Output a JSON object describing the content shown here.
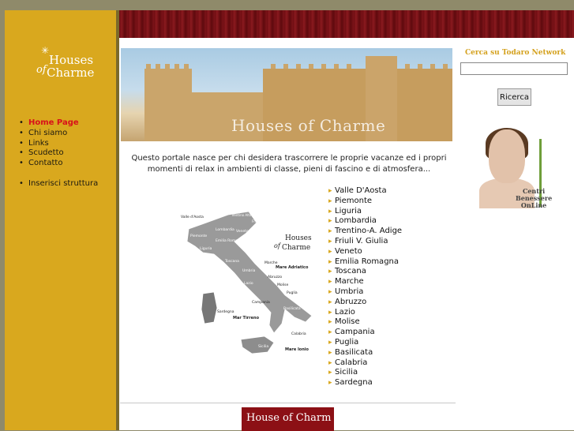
{
  "brand": {
    "logo_houses": "Houses",
    "logo_of": "of",
    "logo_charme": "Charme"
  },
  "nav": {
    "items": [
      {
        "label": "Home Page",
        "active": true
      },
      {
        "label": "Chi siamo"
      },
      {
        "label": "Links"
      },
      {
        "label": "Scudetto"
      },
      {
        "label": "Contatto"
      }
    ],
    "extra": "Inserisci struttura"
  },
  "hero": {
    "title": "Houses of Charme"
  },
  "intro": "Questo portale nasce per chi desidera trascorrere le proprie vacanze ed i propri momenti di relax in ambienti di classe, pieni di fascino e di atmosfera...",
  "regions": [
    "Valle D'Aosta",
    "Piemonte",
    "Liguria",
    "Lombardia",
    "Trentino-A. Adige",
    "Friuli V. Giulia",
    "Veneto",
    "Emilia Romagna",
    "Toscana",
    "Marche",
    "Umbria",
    "Abruzzo",
    "Lazio",
    "Molise",
    "Campania",
    "Puglia",
    "Basilicata",
    "Calabria",
    "Sicilia",
    "Sardegna"
  ],
  "map": {
    "labels": {
      "valle_daosta": "Valle d'Aosta",
      "trentino": "Trentino Alto Adige",
      "friuli": "Friuli",
      "lombardia": "Lombardia",
      "veneto": "Veneto",
      "piemonte": "Piemonte",
      "emilia": "Emilia Romagna",
      "liguria": "Liguria",
      "toscana": "Toscana",
      "marche": "Marche",
      "umbria": "Umbria",
      "abruzzo": "Abruzzo",
      "lazio": "Lazio",
      "molise": "Molise",
      "puglia": "Puglia",
      "campania": "Campania",
      "basilicata": "Basilicata",
      "sardegna": "Sardegna",
      "calabria": "Calabria",
      "sicilia": "Sicilia",
      "mare_adriatico": "Mare Adriatico",
      "mar_tirreno": "Mar Tirreno",
      "mare_ionio": "Mare Ionio"
    }
  },
  "footer_logo": "House of Charm",
  "search": {
    "title": "Cerca su Todaro Network",
    "value": "",
    "button": "Ricerca"
  },
  "ad": {
    "line1": "Centri",
    "line2": "Benessere",
    "line3": "OnLine"
  },
  "colors": {
    "sidebar": "#d9a81e",
    "banner": "#7a1418",
    "active_link": "#d8101a",
    "accent": "#d4a11e"
  }
}
